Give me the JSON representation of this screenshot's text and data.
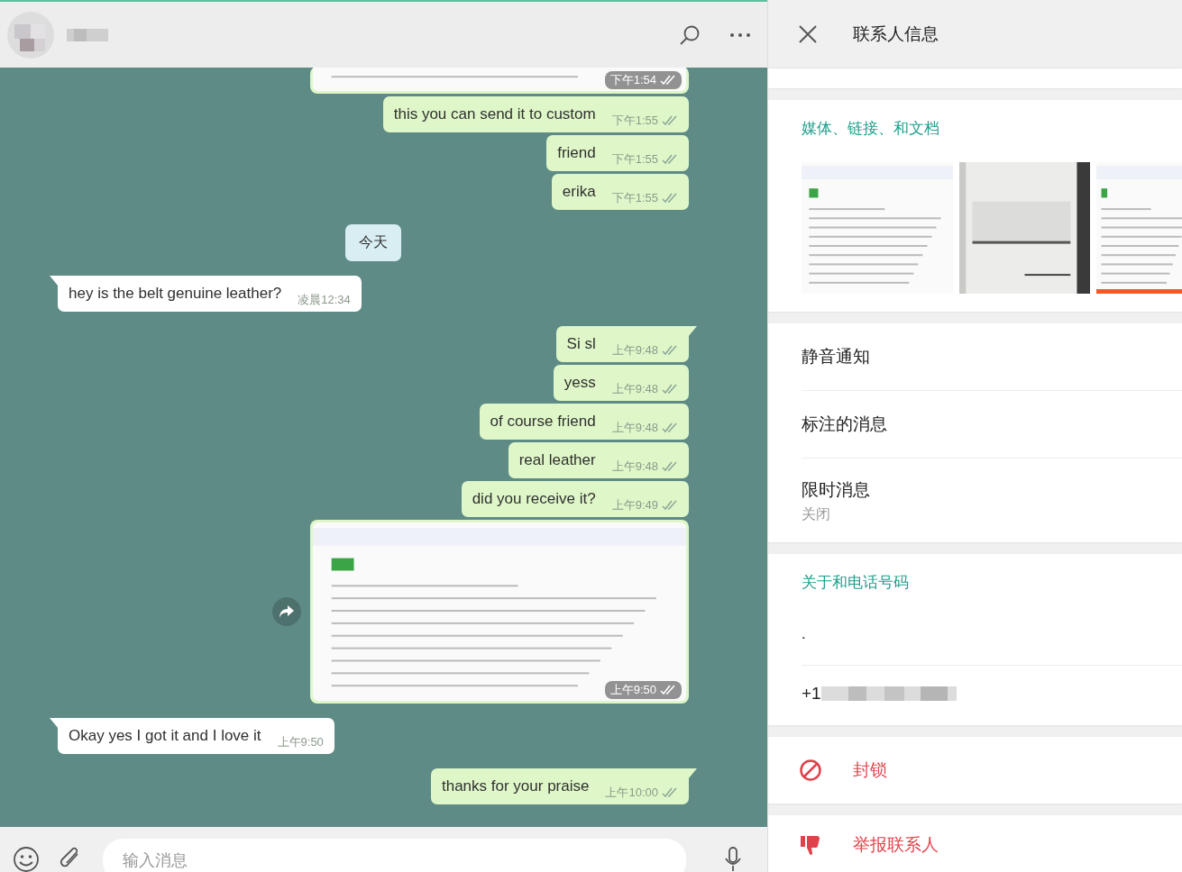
{
  "chat": {
    "messages": [
      {
        "outgoing": true,
        "time": "下午1:54",
        "cut": true
      },
      {
        "kind": "text",
        "outgoing": true,
        "text": "this you can send it to custom",
        "time": "下午1:55",
        "tail": false
      },
      {
        "kind": "text",
        "outgoing": true,
        "text": "friend",
        "time": "下午1:55",
        "tail": false
      },
      {
        "kind": "text",
        "outgoing": true,
        "text": "erika",
        "time": "下午1:55",
        "tail": false
      },
      {
        "kind": "date",
        "text": "今天"
      },
      {
        "kind": "text",
        "outgoing": false,
        "text": "hey is the belt genuine leather?",
        "time": "凌晨12:34",
        "tail": true
      },
      {
        "kind": "text",
        "outgoing": true,
        "text": "Si sl",
        "time": "上午9:48",
        "tail": true
      },
      {
        "kind": "text",
        "outgoing": true,
        "text": "yess",
        "time": "上午9:48",
        "tail": false
      },
      {
        "kind": "text",
        "outgoing": true,
        "text": "of course friend",
        "time": "上午9:48",
        "tail": false
      },
      {
        "kind": "text",
        "outgoing": true,
        "text": "real leather",
        "time": "上午9:48",
        "tail": false
      },
      {
        "kind": "text",
        "outgoing": true,
        "text": "did you receive it?",
        "time": "上午9:49",
        "tail": false
      },
      {
        "outgoing": true,
        "time": "上午9:50",
        "cut": false
      },
      {
        "kind": "text",
        "outgoing": false,
        "text": "Okay yes I got it and I love it",
        "time": "上午9:50",
        "tail": true
      },
      {
        "kind": "text",
        "outgoing": true,
        "text": "thanks for your praise",
        "time": "上午10:00",
        "tail": true
      }
    ],
    "composer": {
      "placeholder": "输入消息"
    }
  },
  "info": {
    "title": "联系人信息",
    "media": {
      "heading": "媒体、链接、和文档"
    },
    "settings": [
      {
        "label": "静音通知"
      },
      {
        "label": "标注的消息"
      },
      {
        "label": "限时消息",
        "value": "关闭"
      }
    ],
    "about": {
      "heading": "关于和电话号码",
      "text": ".",
      "phone": "+1"
    },
    "actions": [
      {
        "kind": "block",
        "label": "封锁"
      },
      {
        "kind": "report",
        "label": "举报联系人"
      }
    ]
  }
}
